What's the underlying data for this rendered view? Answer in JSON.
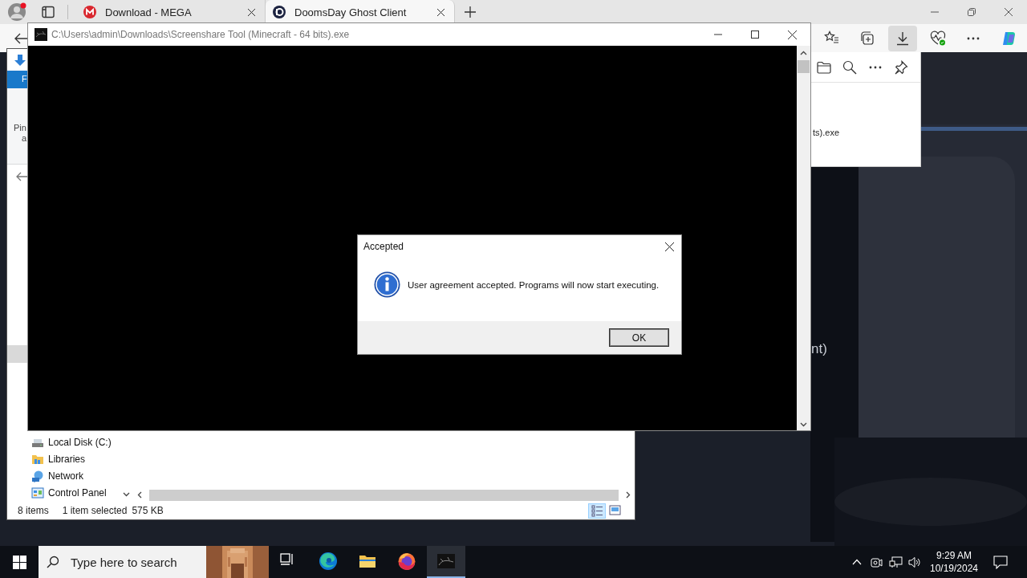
{
  "browser": {
    "tabs": [
      {
        "title": "Download - MEGA",
        "kind": "mega",
        "selected": false
      },
      {
        "title": "DoomsDay Ghost Client",
        "kind": "d",
        "selected": true
      }
    ],
    "toolbar_buttons": [
      {
        "kind": "favorites",
        "selected": false
      },
      {
        "kind": "collections",
        "selected": false
      },
      {
        "kind": "downloads",
        "selected": true
      },
      {
        "kind": "health",
        "selected": false
      },
      {
        "kind": "more",
        "selected": false
      },
      {
        "kind": "copilot",
        "selected": false
      }
    ],
    "downloads_panel": {
      "file_name": "ts).exe"
    },
    "page_text": "nt)"
  },
  "explorer": {
    "ribbon_tab": "F",
    "ribbon_lines": [
      "Pin",
      "a"
    ],
    "nav_items": [
      {
        "label": "Local Disk (C:)",
        "kind": "drive"
      },
      {
        "label": "Libraries",
        "kind": "libraries"
      },
      {
        "label": "Network",
        "kind": "network"
      },
      {
        "label": "Control Panel",
        "kind": "control-panel"
      }
    ],
    "status_bar": {
      "items": "8 items",
      "selection": "1 item selected",
      "size": "575 KB"
    },
    "views": [
      {
        "kind": "details",
        "selected": true
      },
      {
        "kind": "large-icons",
        "selected": false
      }
    ]
  },
  "console": {
    "title": "C:\\Users\\admin\\Downloads\\Screenshare Tool (Minecraft - 64 bits).exe"
  },
  "dialog": {
    "title": "Accepted",
    "message": "User agreement accepted. Programs will now start executing.",
    "buttons": [
      "OK"
    ]
  },
  "taskbar": {
    "search": {
      "placeholder": "Type here to search"
    },
    "apps": [
      {
        "kind": "task-view",
        "selected": false
      },
      {
        "kind": "edge",
        "selected": false
      },
      {
        "kind": "explorer",
        "selected": false
      },
      {
        "kind": "firefox",
        "selected": false
      },
      {
        "kind": "console",
        "selected": true
      }
    ],
    "clock": {
      "time": "9:29 AM",
      "date": "10/19/2024"
    }
  }
}
